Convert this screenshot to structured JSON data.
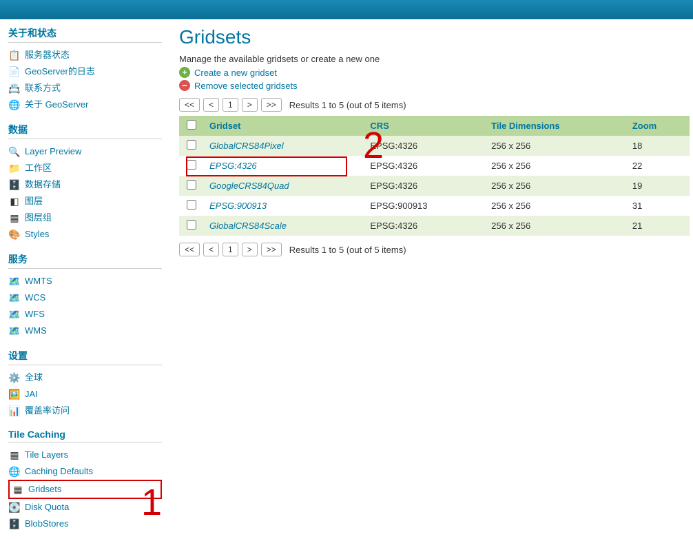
{
  "page": {
    "title": "Gridsets",
    "subtitle": "Manage the available gridsets or create a new one",
    "create_label": "Create a new gridset",
    "remove_label": "Remove selected gridsets",
    "results_text": "Results 1 to 5 (out of 5 items)"
  },
  "pager": {
    "first": "<<",
    "prev": "<",
    "page": "1",
    "next": ">",
    "last": ">>"
  },
  "columns": {
    "gridset": "Gridset",
    "crs": "CRS",
    "tiledim": "Tile Dimensions",
    "zoom": "Zoom"
  },
  "rows": [
    {
      "name": "GlobalCRS84Pixel",
      "crs": "EPSG:4326",
      "dim": "256 x 256",
      "zoom": "18"
    },
    {
      "name": "EPSG:4326",
      "crs": "EPSG:4326",
      "dim": "256 x 256",
      "zoom": "22"
    },
    {
      "name": "GoogleCRS84Quad",
      "crs": "EPSG:4326",
      "dim": "256 x 256",
      "zoom": "19"
    },
    {
      "name": "EPSG:900913",
      "crs": "EPSG:900913",
      "dim": "256 x 256",
      "zoom": "31"
    },
    {
      "name": "GlobalCRS84Scale",
      "crs": "EPSG:4326",
      "dim": "256 x 256",
      "zoom": "21"
    }
  ],
  "annotations": {
    "one": "1",
    "two": "2"
  },
  "sidebar": {
    "about": {
      "title": "关于和状态",
      "items": [
        "服务器状态",
        "GeoServer的日志",
        "联系方式",
        "关于 GeoServer"
      ]
    },
    "data": {
      "title": "数据",
      "items": [
        "Layer Preview",
        "工作区",
        "数据存储",
        "图层",
        "图层组",
        "Styles"
      ]
    },
    "services": {
      "title": "服务",
      "items": [
        "WMTS",
        "WCS",
        "WFS",
        "WMS"
      ]
    },
    "settings": {
      "title": "设置",
      "items": [
        "全球",
        "JAI",
        "覆盖率访问"
      ]
    },
    "cache": {
      "title": "Tile Caching",
      "items": [
        "Tile Layers",
        "Caching Defaults",
        "Gridsets",
        "Disk Quota",
        "BlobStores"
      ]
    }
  }
}
